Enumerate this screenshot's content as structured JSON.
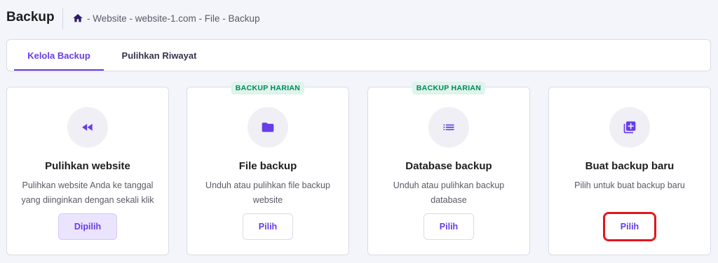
{
  "header": {
    "title": "Backup",
    "breadcrumb": "- Website - website-1.com - File - Backup"
  },
  "tabs": [
    {
      "label": "Kelola Backup",
      "active": true
    },
    {
      "label": "Pulihkan Riwayat",
      "active": false
    }
  ],
  "cards": [
    {
      "icon": "rewind-icon",
      "badge": "",
      "title": "Pulihkan website",
      "description": "Pulihkan website Anda ke tanggal yang diinginkan dengan sekali klik",
      "button": "Dipilih"
    },
    {
      "icon": "folder-icon",
      "badge": "BACKUP HARIAN",
      "title": "File backup",
      "description": "Unduh atau pulihkan file backup website",
      "button": "Pilih"
    },
    {
      "icon": "list-icon",
      "badge": "BACKUP HARIAN",
      "title": "Database backup",
      "description": "Unduh atau pulihkan backup database",
      "button": "Pilih"
    },
    {
      "icon": "add-library-icon",
      "badge": "",
      "title": "Buat backup baru",
      "description": "Pilih untuk buat backup baru",
      "button": "Pilih"
    }
  ],
  "colors": {
    "accent": "#673de6",
    "badge_bg": "#def4ec",
    "badge_text": "#00875a",
    "highlight": "#e0161d",
    "background": "#f4f4fb"
  }
}
